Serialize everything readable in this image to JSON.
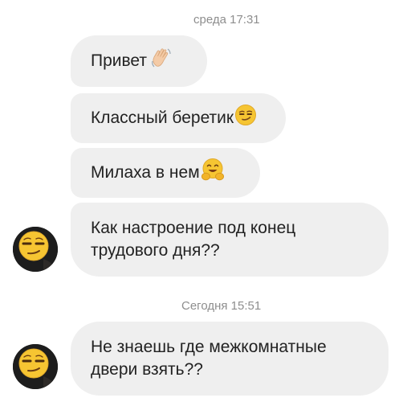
{
  "conversation": {
    "timestamps": [
      "среда 17:31",
      "Сегодня 15:51"
    ],
    "messages": [
      {
        "text": "Привет",
        "emoji": "waving-hand-icon"
      },
      {
        "text": "Классный беретик",
        "emoji": "smirking-face-icon"
      },
      {
        "text": "Милаха в нем",
        "emoji": "hugging-face-icon"
      },
      {
        "text": "Как настроение под конец трудового дня??",
        "emoji": ""
      },
      {
        "text": "Не знаешь где межкомнатные двери взять??",
        "emoji": ""
      }
    ],
    "avatar_icon": "smirking-face-avatar-icon"
  },
  "colors": {
    "bubble_bg": "#efefef",
    "timestamp_text": "#8e8e8e",
    "message_text": "#222222",
    "emoji_yellow": "#f6c532"
  }
}
